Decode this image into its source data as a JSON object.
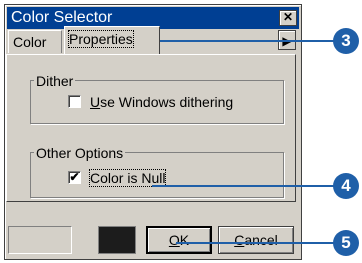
{
  "window": {
    "title": "Color Selector",
    "close_glyph": "✕"
  },
  "tabs": {
    "color": "Color",
    "properties": "Properties",
    "scroll_arrow": "▶"
  },
  "dither_group": {
    "label": "Dither",
    "checkbox_label_underlined": "U",
    "checkbox_label_rest": "se Windows dithering",
    "checked": false
  },
  "other_group": {
    "label": "Other Options",
    "checkbox_label": "Color is Null",
    "checkbox_mark": "✔",
    "checked": true
  },
  "buttons": {
    "ok_underlined": "O",
    "ok_rest": "K",
    "cancel_underlined": "C",
    "cancel_rest": "ancel"
  },
  "preview": {
    "selected_color": "#1c1c1c"
  },
  "callouts": [
    {
      "label": "3"
    },
    {
      "label": "4"
    },
    {
      "label": "5"
    }
  ],
  "colors": {
    "titlebar": "#003f93",
    "dialog_face": "#d4d0c8",
    "callout": "#1f5fa8"
  }
}
